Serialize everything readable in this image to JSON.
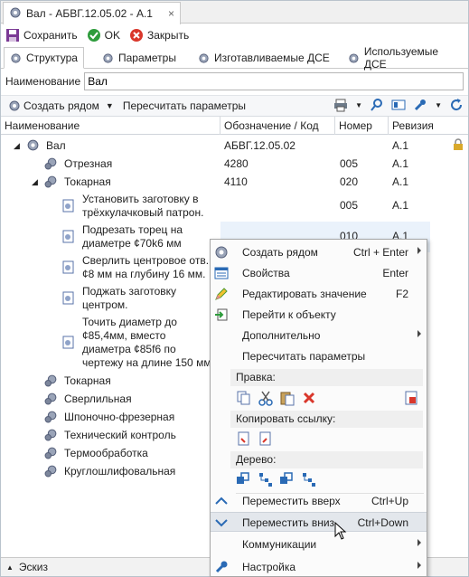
{
  "window": {
    "tab_title": "Вал - АБВГ.12.05.02 - А.1"
  },
  "toolbar": {
    "save": "Сохранить",
    "ok": "OK",
    "close": "Закрыть"
  },
  "tabs": [
    {
      "label": "Структура",
      "active": true
    },
    {
      "label": "Параметры",
      "active": false
    },
    {
      "label": "Изготавливаемые ДСЕ",
      "active": false
    },
    {
      "label": "Используемые ДСЕ",
      "active": false
    }
  ],
  "name_field": {
    "label": "Наименование",
    "value": "Вал"
  },
  "tree_toolbar": {
    "create_near": "Создать рядом",
    "recalc": "Пересчитать параметры"
  },
  "grid": {
    "columns": [
      "Наименование",
      "Обозначение / Код",
      "Номер",
      "Ревизия"
    ],
    "rows": [
      {
        "name": "Вал",
        "code": "АБВГ.12.05.02",
        "num": "",
        "rev": "А.1"
      },
      {
        "name": "Отрезная",
        "code": "4280",
        "num": "005",
        "rev": "А.1"
      },
      {
        "name": "Токарная",
        "code": "4110",
        "num": "020",
        "rev": "А.1"
      },
      {
        "name": "Установить заготовку в трёхкулачковый патрон.",
        "code": "",
        "num": "005",
        "rev": "А.1"
      },
      {
        "name": "Подрезать торец на диаметре ¢70k6 мм",
        "code": "",
        "num": "010",
        "rev": "А.1"
      },
      {
        "name": "Сверлить центровое отв. ¢8 мм на глубину 16 мм.",
        "code": "",
        "num": "",
        "rev": ""
      },
      {
        "name": "Поджать заготовку центром.",
        "code": "",
        "num": "",
        "rev": ""
      },
      {
        "name": "Точить диаметр до ¢85,4мм, вместо диаметра ¢85f6 по чертежу на длине 150 мм",
        "code": "",
        "num": "",
        "rev": ""
      },
      {
        "name": "Токарная",
        "code": "",
        "num": "",
        "rev": ""
      },
      {
        "name": "Сверлильная",
        "code": "",
        "num": "",
        "rev": ""
      },
      {
        "name": "Шпоночно-фрезерная",
        "code": "",
        "num": "",
        "rev": ""
      },
      {
        "name": "Технический контроль",
        "code": "",
        "num": "",
        "rev": ""
      },
      {
        "name": "Термообработка",
        "code": "",
        "num": "",
        "rev": ""
      },
      {
        "name": "Круглошлифовальная",
        "code": "",
        "num": "",
        "rev": ""
      }
    ]
  },
  "footer": {
    "label": "Эскиз"
  },
  "context_menu": {
    "create_near": "Создать рядом",
    "create_near_sc": "Ctrl + Enter",
    "properties": "Свойства",
    "properties_sc": "Enter",
    "edit_value": "Редактировать значение",
    "edit_value_sc": "F2",
    "goto_object": "Перейти к объекту",
    "additional": "Дополнительно",
    "recalc": "Пересчитать параметры",
    "edit_section": "Правка:",
    "copy_link_section": "Копировать ссылку:",
    "tree_section": "Дерево:",
    "move_up": "Переместить вверх",
    "move_up_sc": "Ctrl+Up",
    "move_down": "Переместить вниз",
    "move_down_sc": "Ctrl+Down",
    "communications": "Коммуникации",
    "settings": "Настройка"
  }
}
